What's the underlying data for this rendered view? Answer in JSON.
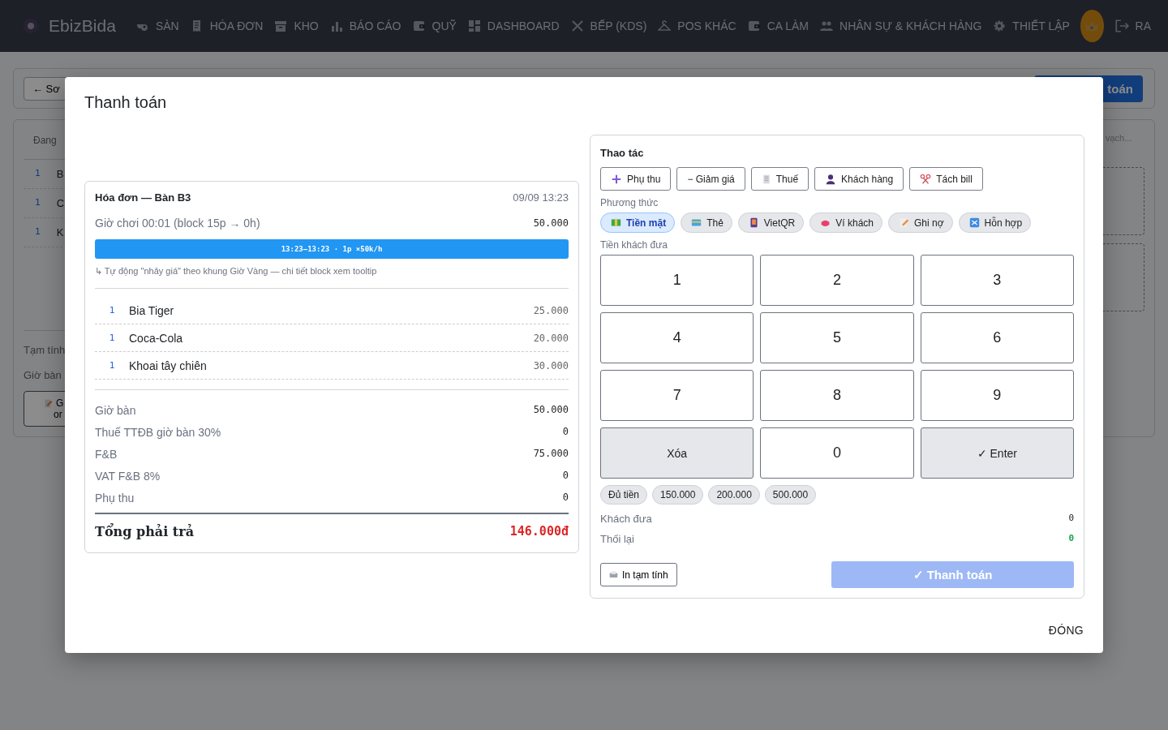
{
  "nav": {
    "brand": "EbizBida",
    "items": [
      {
        "label": "SÀN"
      },
      {
        "label": "HÓA ĐƠN"
      },
      {
        "label": "KHO"
      },
      {
        "label": "BÁO CÁO"
      },
      {
        "label": "QUỸ"
      },
      {
        "label": "DASHBOARD"
      },
      {
        "label": "BẾP (KDS)"
      },
      {
        "label": "POS KHÁC"
      },
      {
        "label": "CA LÀM"
      },
      {
        "label": "NHÂN SỰ & KHÁCH HÀNG"
      },
      {
        "label": "THIẾT LẬP"
      }
    ],
    "logout": "RA"
  },
  "background": {
    "back_button": "← Sơ",
    "pay_button": "toán",
    "list_header": "Đang",
    "rows": [
      {
        "qty": "1",
        "name": "B"
      },
      {
        "qty": "1",
        "name": "C"
      },
      {
        "qty": "1",
        "name": "K"
      }
    ],
    "subtotal_label": "Tạm tính",
    "table_time_label": "Giờ bàn",
    "order_button": [
      "G",
      "or"
    ],
    "search_placeholder": "vạch..."
  },
  "modal": {
    "title": "Thanh toán",
    "close_button": "ĐÓNG",
    "bill": {
      "title": "Hóa đơn — Bàn B3",
      "time": "09/09 13:23",
      "play_time": "Giờ chơi 00:01 (block 15p → 0h)",
      "play_amount": "50.000",
      "block_bar": "13:23–13:23 · 1p ×50k/h",
      "note": "↳ Tự động \"nhảy giá\" theo khung Giờ Vàng — chi tiết block xem tooltip",
      "items": [
        {
          "qty": "1",
          "name": "Bia Tiger",
          "price": "25.000"
        },
        {
          "qty": "1",
          "name": "Coca-Cola",
          "price": "20.000"
        },
        {
          "qty": "1",
          "name": "Khoai tây chiên",
          "price": "30.000"
        }
      ],
      "summary": [
        {
          "label": "Giờ bàn",
          "value": "50.000"
        },
        {
          "label": "Thuế TTĐB giờ bàn 30%",
          "value": "0"
        },
        {
          "label": "F&B",
          "value": "75.000"
        },
        {
          "label": "VAT F&B 8%",
          "value": "0"
        },
        {
          "label": "Phụ thu",
          "value": "0"
        }
      ],
      "total_label": "Tổng phải trả",
      "total_value": "146.000đ"
    },
    "panel": {
      "actions_title": "Thao tác",
      "actions": [
        {
          "label": "Phụ thu"
        },
        {
          "label": "− Giảm giá"
        },
        {
          "label": "Thuế"
        },
        {
          "label": "Khách hàng"
        },
        {
          "label": "Tách bill"
        }
      ],
      "methods_label": "Phương thức",
      "methods": [
        {
          "label": "Tiền mặt",
          "selected": true
        },
        {
          "label": "Thẻ",
          "selected": false
        },
        {
          "label": "VietQR",
          "selected": false
        },
        {
          "label": "Ví khách",
          "selected": false
        },
        {
          "label": "Ghi nợ",
          "selected": false
        },
        {
          "label": "Hỗn hợp",
          "selected": false
        }
      ],
      "cash_label": "Tiền khách đưa",
      "keys": [
        {
          "label": "1",
          "kind": "digit"
        },
        {
          "label": "2",
          "kind": "digit"
        },
        {
          "label": "3",
          "kind": "digit"
        },
        {
          "label": "4",
          "kind": "digit"
        },
        {
          "label": "5",
          "kind": "digit"
        },
        {
          "label": "6",
          "kind": "digit"
        },
        {
          "label": "7",
          "kind": "digit"
        },
        {
          "label": "8",
          "kind": "digit"
        },
        {
          "label": "9",
          "kind": "digit"
        },
        {
          "label": "Xóa",
          "kind": "action"
        },
        {
          "label": "0",
          "kind": "digit"
        },
        {
          "label": "✓ Enter",
          "kind": "action"
        }
      ],
      "quick_amounts": [
        "Đủ tiền",
        "150.000",
        "200.000",
        "500.000"
      ],
      "given_label": "Khách đưa",
      "given_value": "0",
      "change_label": "Thối lại",
      "change_value": "0",
      "print_button": "In tạm tính",
      "pay_button": {
        "label": "✓ Thanh toán",
        "disabled": true
      }
    }
  }
}
